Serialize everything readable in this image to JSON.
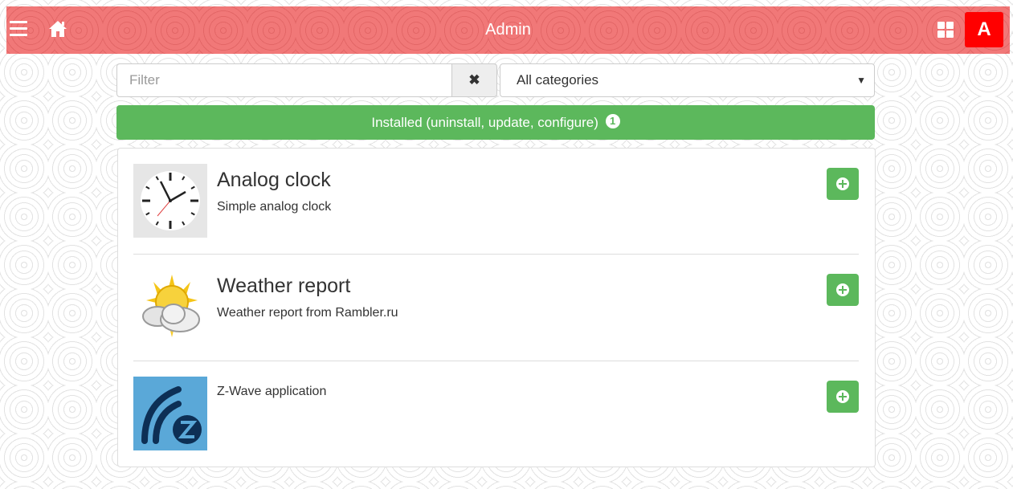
{
  "header": {
    "title": "Admin",
    "avatar_letter": "A",
    "menu_icon": "hamburger-menu-icon",
    "home_icon": "home-icon",
    "apps_icon": "grid-icon",
    "bar_color": "#f17878",
    "avatar_color": "#ff0000"
  },
  "filter": {
    "placeholder": "Filter",
    "value": "",
    "clear_icon": "close-icon",
    "category_selected": "All categories"
  },
  "installed_bar": {
    "label": "Installed (uninstall, update, configure)",
    "count": "1",
    "color": "#5cb85c"
  },
  "apps": [
    {
      "title": "Analog clock",
      "description": "Simple analog clock",
      "icon": "clock-icon"
    },
    {
      "title": "Weather report",
      "description": "Weather report from Rambler.ru",
      "icon": "weather-sun-cloud-icon"
    },
    {
      "title": "",
      "description": "Z-Wave application",
      "icon": "zwave-logo-icon"
    }
  ],
  "add_button_icon": "plus-circle-icon"
}
